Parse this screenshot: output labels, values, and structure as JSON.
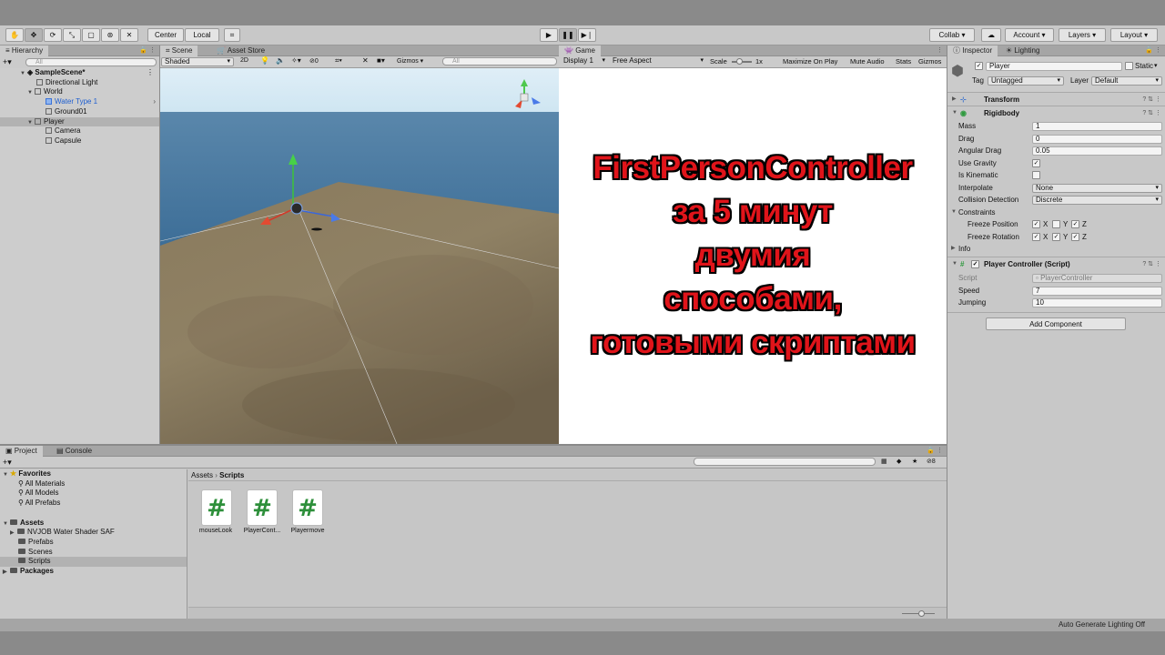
{
  "toolbar": {
    "pivot": "Center",
    "space": "Local",
    "collab": "Collab",
    "account": "Account",
    "layers": "Layers",
    "layout": "Layout"
  },
  "hierarchy": {
    "tab": "Hierarchy",
    "search_placeholder": "All",
    "items": [
      {
        "label": "SampleScene*"
      },
      {
        "label": "Directional Light"
      },
      {
        "label": "World"
      },
      {
        "label": "Water Type 1"
      },
      {
        "label": "Ground01"
      },
      {
        "label": "Player"
      },
      {
        "label": "Camera"
      },
      {
        "label": "Capsule"
      }
    ]
  },
  "scene": {
    "tabs": [
      "Scene",
      "Asset Store"
    ],
    "shading": "Shaded",
    "mode_2d": "2D",
    "fx_count": "0",
    "gizmos": "Gizmos",
    "search_placeholder": "All"
  },
  "game": {
    "tab": "Game",
    "display": "Display 1",
    "aspect": "Free Aspect",
    "scale_label": "Scale",
    "scale_value": "1x",
    "maximize": "Maximize On Play",
    "mute": "Mute Audio",
    "stats": "Stats",
    "gizmos": "Gizmos",
    "overlay_lines": [
      "FirstPersonController",
      "за 5 минут",
      "двумия",
      "способами,",
      "готовыми скриптами"
    ]
  },
  "inspector": {
    "tabs": [
      "Inspector",
      "Lighting"
    ],
    "object_name": "Player",
    "static_label": "Static",
    "tag_label": "Tag",
    "tag_value": "Untagged",
    "layer_label": "Layer",
    "layer_value": "Default",
    "transform": "Transform",
    "rigidbody": {
      "title": "Rigidbody",
      "mass_label": "Mass",
      "mass": "1",
      "drag_label": "Drag",
      "drag": "0",
      "angular_label": "Angular Drag",
      "angular": "0.05",
      "gravity_label": "Use Gravity",
      "gravity": "✓",
      "kinematic_label": "Is Kinematic",
      "kinematic": "",
      "interp_label": "Interpolate",
      "interp": "None",
      "collision_label": "Collision Detection",
      "collision": "Discrete",
      "constraints_label": "Constraints",
      "freeze_pos_label": "Freeze Position",
      "freeze_rot_label": "Freeze Rotation",
      "axis_x": "X",
      "axis_y": "Y",
      "axis_z": "Z",
      "info_label": "Info"
    },
    "script": {
      "title": "Player Controller (Script)",
      "script_label": "Script",
      "script_value": "PlayerController",
      "speed_label": "Speed",
      "speed": "7",
      "jump_label": "Jumping",
      "jump": "10"
    },
    "add_component": "Add Component"
  },
  "project": {
    "tabs": [
      "Project",
      "Console"
    ],
    "tree": [
      {
        "label": "Favorites"
      },
      {
        "label": "All Materials"
      },
      {
        "label": "All Models"
      },
      {
        "label": "All Prefabs"
      },
      {
        "label": "Assets"
      },
      {
        "label": "NVJOB Water Shader SAF"
      },
      {
        "label": "Prefabs"
      },
      {
        "label": "Scenes"
      },
      {
        "label": "Scripts"
      },
      {
        "label": "Packages"
      }
    ],
    "breadcrumb_root": "Assets",
    "breadcrumb_current": "Scripts",
    "assets": [
      {
        "glyph": "#",
        "label": "mouseLook"
      },
      {
        "glyph": "#",
        "label": "PlayerCont..."
      },
      {
        "glyph": "#",
        "label": "Playermove"
      }
    ],
    "hidden_count": "8"
  },
  "status": {
    "lighting": "Auto Generate Lighting Off"
  },
  "colors": {
    "overlay_text": "#e0141a",
    "selection": "#3a72d8",
    "script_glyph": "#2d8f3a"
  }
}
